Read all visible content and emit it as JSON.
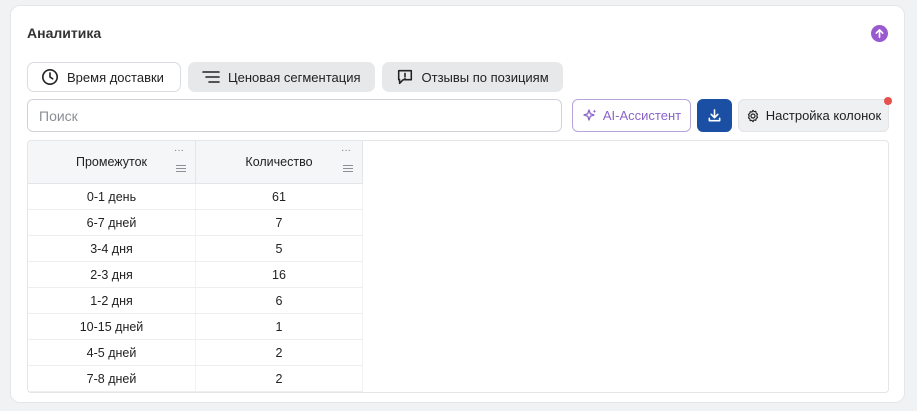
{
  "panel": {
    "title": "Аналитика"
  },
  "tabs": [
    {
      "label": "Время доставки",
      "icon": "clock-icon",
      "active": true
    },
    {
      "label": "Ценовая сегментация",
      "icon": "filter-lines-icon",
      "active": false
    },
    {
      "label": "Отзывы по позициям",
      "icon": "comment-alert-icon",
      "active": false
    }
  ],
  "toolbar": {
    "search_placeholder": "Поиск",
    "ai_label": "AI-Ассистент",
    "columns_label": "Настройка колонок"
  },
  "table": {
    "headers": [
      "Промежуток",
      "Количество"
    ],
    "rows": [
      [
        "0-1 день",
        "61"
      ],
      [
        "6-7 дней",
        "7"
      ],
      [
        "3-4 дня",
        "5"
      ],
      [
        "2-3 дня",
        "16"
      ],
      [
        "1-2 дня",
        "6"
      ],
      [
        "10-15 дней",
        "1"
      ],
      [
        "4-5 дней",
        "2"
      ],
      [
        "7-8 дней",
        "2"
      ]
    ]
  },
  "colors": {
    "accent_purple": "#9b59d0",
    "download_blue": "#1a4fa3",
    "notification_red": "#e6504d"
  }
}
